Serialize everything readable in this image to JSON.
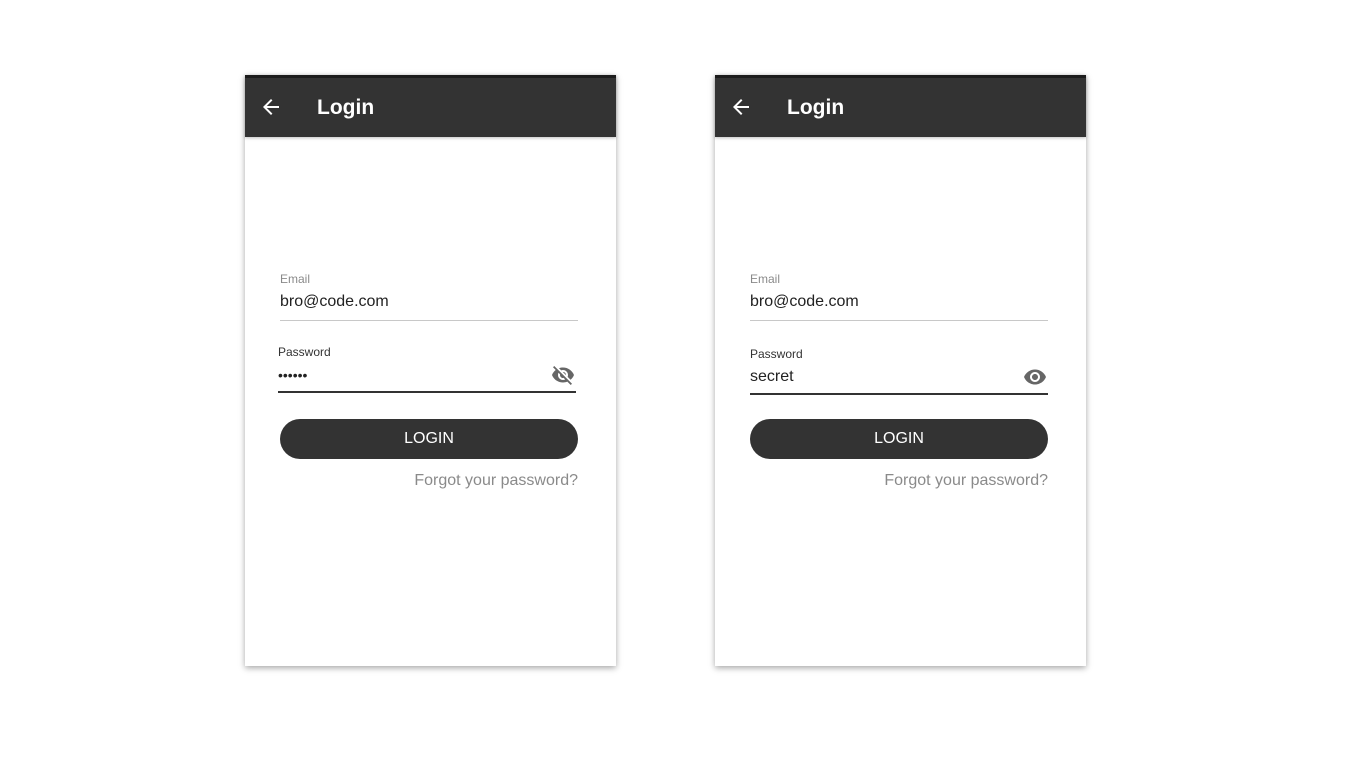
{
  "screens": [
    {
      "title": "Login",
      "email": {
        "label": "Email",
        "value": "bro@code.com"
      },
      "password": {
        "label": "Password",
        "value": "••••••",
        "visibility_icon": "eye-off-icon"
      },
      "login_button": "LOGIN",
      "forgot_link": "Forgot your password?"
    },
    {
      "title": "Login",
      "email": {
        "label": "Email",
        "value": "bro@code.com"
      },
      "password": {
        "label": "Password",
        "value": "secret",
        "visibility_icon": "eye-icon"
      },
      "login_button": "LOGIN",
      "forgot_link": "Forgot your password?"
    }
  ],
  "colors": {
    "appbar": "#333333",
    "button": "#333333",
    "muted_text": "#8a8a8a"
  }
}
